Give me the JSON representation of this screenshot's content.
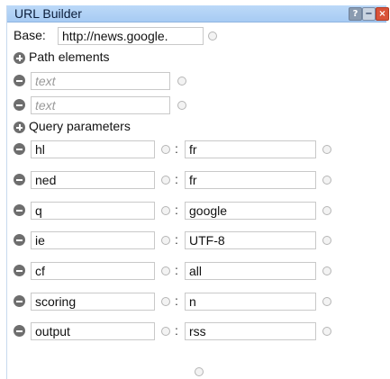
{
  "window": {
    "title": "URL Builder",
    "help_icon": "question-mark",
    "minimize_icon": "minus",
    "close_icon": "x"
  },
  "base": {
    "label": "Base:",
    "value": "http://news.google."
  },
  "path": {
    "heading": "Path elements",
    "items": [
      {
        "placeholder": "text"
      },
      {
        "placeholder": "text"
      }
    ]
  },
  "query": {
    "heading": "Query parameters",
    "separator": ":",
    "params": [
      {
        "key": "hl",
        "value": "fr"
      },
      {
        "key": "ned",
        "value": "fr"
      },
      {
        "key": "q",
        "value": "google"
      },
      {
        "key": "ie",
        "value": "UTF-8"
      },
      {
        "key": "cf",
        "value": "all"
      },
      {
        "key": "scoring",
        "value": "n"
      },
      {
        "key": "output",
        "value": "rss"
      }
    ]
  }
}
